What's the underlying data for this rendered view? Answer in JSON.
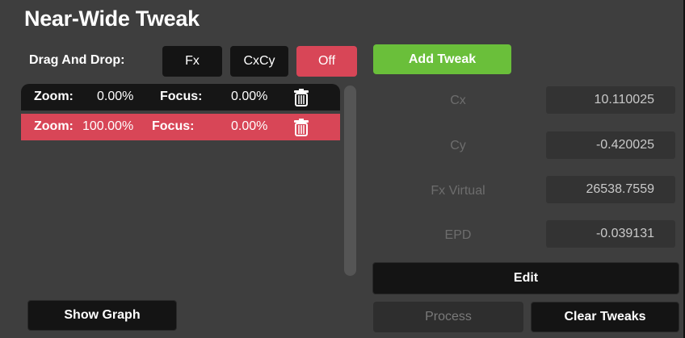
{
  "title": "Near-Wide Tweak",
  "drag_and_drop": {
    "label": "Drag And Drop:",
    "options": [
      "Fx",
      "CxCy",
      "Off"
    ],
    "selected": "Off"
  },
  "tweaks": {
    "rows": [
      {
        "zoom_label": "Zoom:",
        "zoom_value": "0.00%",
        "focus_label": "Focus:",
        "focus_value": "0.00%"
      },
      {
        "zoom_label": "Zoom:",
        "zoom_value": "100.00%",
        "focus_label": "Focus:",
        "focus_value": "0.00%"
      }
    ]
  },
  "buttons": {
    "add_tweak": "Add Tweak",
    "edit": "Edit",
    "process": "Process",
    "clear_tweaks": "Clear Tweaks",
    "show_graph": "Show Graph"
  },
  "fields": [
    {
      "label": "Cx",
      "value": "10.110025"
    },
    {
      "label": "Cy",
      "value": "-0.420025"
    },
    {
      "label": "Fx Virtual",
      "value": "26538.7559"
    },
    {
      "label": "EPD",
      "value": "-0.039131"
    }
  ],
  "colors": {
    "panel_bg": "#3e3e3e",
    "accent_red": "#d84657",
    "accent_green": "#6abf3a",
    "button_dark": "#141414"
  }
}
